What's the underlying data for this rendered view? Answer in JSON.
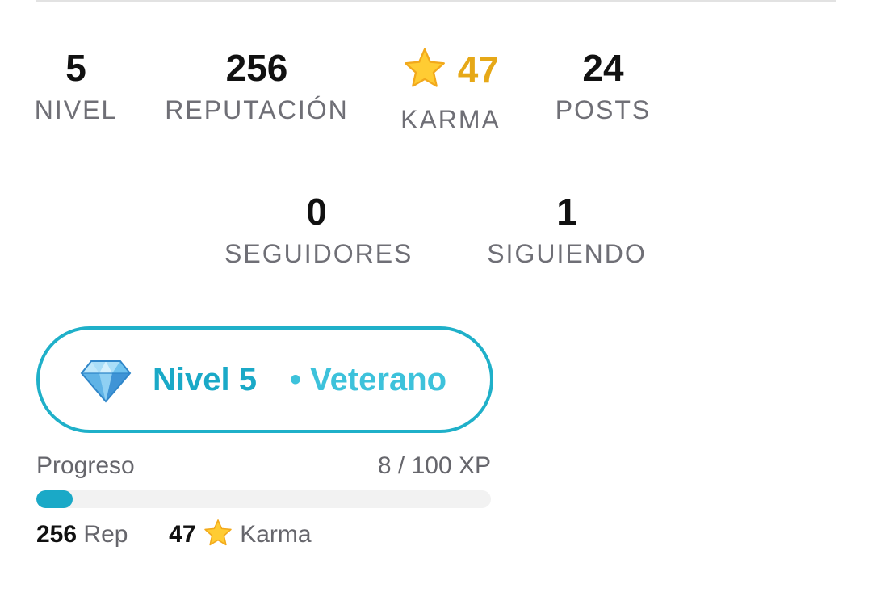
{
  "stats": {
    "nivel": {
      "value": "5",
      "label": "NIVEL"
    },
    "reputacion": {
      "value": "256",
      "label": "REPUTACIÓN"
    },
    "karma": {
      "value": "47",
      "label": "KARMA",
      "icon": "star-icon"
    },
    "posts": {
      "value": "24",
      "label": "POSTS"
    },
    "seguidores": {
      "value": "0",
      "label": "SEGUIDORES"
    },
    "siguiendo": {
      "value": "1",
      "label": "SIGUIENDO"
    }
  },
  "level_badge": {
    "icon": "diamond-icon",
    "level": "Nivel 5",
    "rank": "• Veterano",
    "accent_color": "#1aa9c7"
  },
  "progress": {
    "label": "Progreso",
    "xp_text": "8 / 100 XP",
    "fraction": 0.08
  },
  "summary": {
    "rep_value": "256",
    "rep_unit": "Rep",
    "karma_value": "47",
    "karma_unit": "Karma"
  },
  "colors": {
    "karma": "#e6a817",
    "accent": "#1aa9c7",
    "label": "#6f6f76"
  }
}
